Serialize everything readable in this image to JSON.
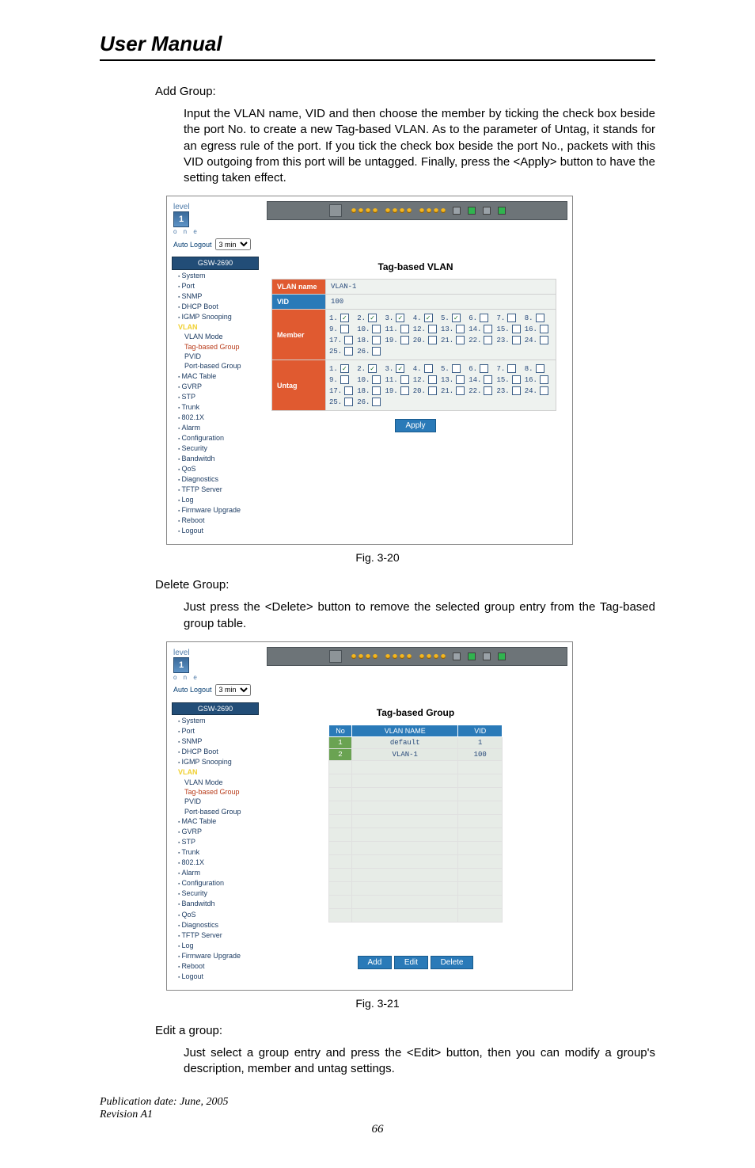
{
  "doc": {
    "title": "User Manual",
    "section_add_heading": "Add Group:",
    "section_add_body": "Input the VLAN name, VID and then choose the member by ticking the check box beside the port No. to create a new Tag-based VLAN. As to the parameter of Untag, it stands for an egress rule of the port. If you tick the check box beside the port No., packets with this VID outgoing from this port will be untagged. Finally, press the <Apply> button to have the setting taken effect.",
    "fig_caption_1": "Fig. 3-20",
    "section_delete_heading": "Delete Group:",
    "section_delete_body": "Just press the <Delete> button to remove the selected group entry from the Tag-based group table.",
    "fig_caption_2": "Fig. 3-21",
    "section_edit_heading": "Edit a group:",
    "section_edit_body": "Just select a group entry and press the  <Edit> button, then you can modify a group's description, member and untag settings.",
    "pub_date": "Publication date: June, 2005",
    "revision": "Revision A1",
    "page_num": "66"
  },
  "device": {
    "logo_word": "level",
    "logo_sub": "o n e",
    "auto_logout_label": "Auto Logout",
    "auto_logout_value": "3 min",
    "model": "GSW-2690"
  },
  "nav": {
    "items_top": [
      "System",
      "Port",
      "SNMP",
      "DHCP Boot",
      "IGMP Snooping"
    ],
    "vlan_label": "VLAN",
    "vlan_sub": [
      "VLAN Mode",
      "Tag-based Group",
      "PVID",
      "Port-based Group"
    ],
    "items_rest": [
      "MAC Table",
      "GVRP",
      "STP",
      "Trunk",
      "802.1X",
      "Alarm",
      "Configuration",
      "Security",
      "Bandwitdh",
      "QoS",
      "Diagnostics",
      "TFTP Server",
      "Log",
      "Firmware Upgrade",
      "Reboot",
      "Logout"
    ]
  },
  "panel1": {
    "title": "Tag-based VLAN",
    "row_vlan_name_label": "VLAN name",
    "row_vlan_name_value": "VLAN-1",
    "row_vid_label": "VID",
    "row_vid_value": "100",
    "row_member_label": "Member",
    "row_untag_label": "Untag",
    "member_checked": [
      1,
      2,
      3,
      4,
      5
    ],
    "untag_checked": [
      1,
      2,
      3
    ],
    "port_count": 26,
    "apply_label": "Apply"
  },
  "panel2": {
    "title": "Tag-based Group",
    "cols": [
      "No",
      "VLAN NAME",
      "VID"
    ],
    "rows": [
      {
        "no": "1",
        "name": "default",
        "vid": "1"
      },
      {
        "no": "2",
        "name": "VLAN-1",
        "vid": "100"
      }
    ],
    "empty_rows": 12,
    "btn_add": "Add",
    "btn_edit": "Edit",
    "btn_delete": "Delete"
  }
}
